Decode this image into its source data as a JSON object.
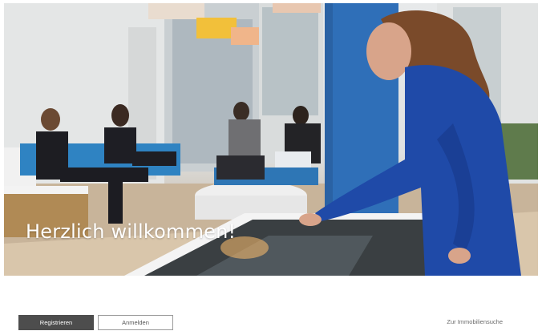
{
  "hero": {
    "title": "Herzlich willkommen!"
  },
  "actions": {
    "register_label": "Registrieren",
    "login_label": "Anmelden",
    "property_search_label": "Zur Immobiliensuche"
  },
  "colors": {
    "primary_button": "#4d4d4d",
    "accent_blue": "#2f6fb8"
  }
}
